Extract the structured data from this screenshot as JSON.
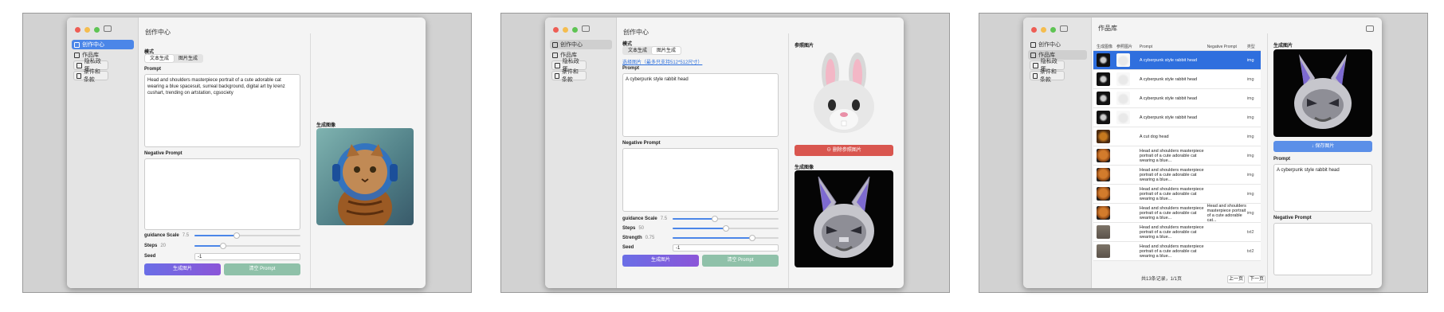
{
  "nav": [
    {
      "label": "创作中心"
    },
    {
      "label": "作品库"
    },
    {
      "label": "隐私政策"
    },
    {
      "label": "条件和条款"
    }
  ],
  "p1": {
    "title": "创作中心",
    "mode_label": "模式",
    "mode_text": "文本生成",
    "mode_image": "图片生成",
    "prompt_label": "Prompt",
    "prompt_text": "Head and shoulders masterpiece portrait of a cute adorable cat wearing a blue spacesuit, surreal background, digital art by krenz cushart, trending on artstation, cgsociety",
    "neg_label": "Negative Prompt",
    "neg_text": "",
    "guidance_label": "guidance Scale",
    "guidance_val": "7.5",
    "guidance_frac": 0.4,
    "steps_label": "Steps",
    "steps_val": "20",
    "steps_frac": 0.27,
    "seed_label": "Seed",
    "seed_val": "-1",
    "gen_btn": "生成图片",
    "clear_btn": "清空 Prompt",
    "result_label": "生成图像"
  },
  "p2": {
    "title": "创作中心",
    "mode_label": "模式",
    "mode_text": "文本生成",
    "mode_image": "图片生成",
    "select_link": "选择图片（最多只支持512*512尺寸）",
    "prompt_label": "Prompt",
    "prompt_text": "A cyberpunk style rabbit head",
    "neg_label": "Negative Prompt",
    "neg_text": "",
    "guidance_label": "guidance Scale",
    "guidance_val": "7.5",
    "guidance_frac": 0.4,
    "steps_label": "Steps",
    "steps_val": "50",
    "steps_frac": 0.5,
    "strength_label": "Strength",
    "strength_val": "0.75",
    "strength_frac": 0.75,
    "seed_label": "Seed",
    "seed_val": "-1",
    "gen_btn": "生成图片",
    "clear_btn": "清空 Prompt",
    "ref_label": "参照图片",
    "delete_ref_btn": "删除参照图片",
    "result_label": "生成图像"
  },
  "p3": {
    "title": "作品库",
    "headers": [
      "生成图像",
      "参照图片",
      "Prompt",
      "Negative Prompt",
      "类型"
    ],
    "rows": [
      {
        "prompt": "A cyberpunk style rabbit head",
        "neg": "",
        "type": "img"
      },
      {
        "prompt": "A cyberpunk style rabbit head",
        "neg": "",
        "type": "img"
      },
      {
        "prompt": "A cyberpunk style rabbit head",
        "neg": "",
        "type": "img"
      },
      {
        "prompt": "A cyberpunk style rabbit head",
        "neg": "",
        "type": "img"
      },
      {
        "prompt": "A cut dog head",
        "neg": "",
        "type": "img"
      },
      {
        "prompt": "Head and shoulders masterpiece portrait of a cute adorable cat wearing a blue...",
        "neg": "",
        "type": "img"
      },
      {
        "prompt": "Head and shoulders masterpiece portrait of a cute adorable cat wearing a blue...",
        "neg": "",
        "type": "img"
      },
      {
        "prompt": "Head and shoulders masterpiece portrait of a cute adorable cat wearing a blue...",
        "neg": "",
        "type": "img"
      },
      {
        "prompt": "Head and shoulders masterpiece portrait of a cute adorable cat wearing a blue...",
        "neg": "Head and shoulders masterpiece portrait of a cute adorable cat...",
        "type": "img"
      },
      {
        "prompt": "Head and shoulders masterpiece portrait of a cute adorable cat wearing a blue...",
        "neg": "",
        "type": "txt2"
      },
      {
        "prompt": "Head and shoulders masterpiece portrait of a cute adorable cat wearing a blue...",
        "neg": "",
        "type": "txt2"
      }
    ],
    "pager_text": "共13条记录，1/1页",
    "prev_btn": "上一页",
    "next_btn": "下一页",
    "detail_img_label": "生成图片",
    "save_btn": "↓ 保存图片",
    "prompt_label": "Prompt",
    "prompt_text": "A cyberpunk style rabbit head",
    "neg_label": "Negative Prompt"
  },
  "colors": {
    "accent": "#4b86e8",
    "purple": "#7b63e0",
    "green": "#8fc1a9",
    "red": "#d9564f"
  }
}
